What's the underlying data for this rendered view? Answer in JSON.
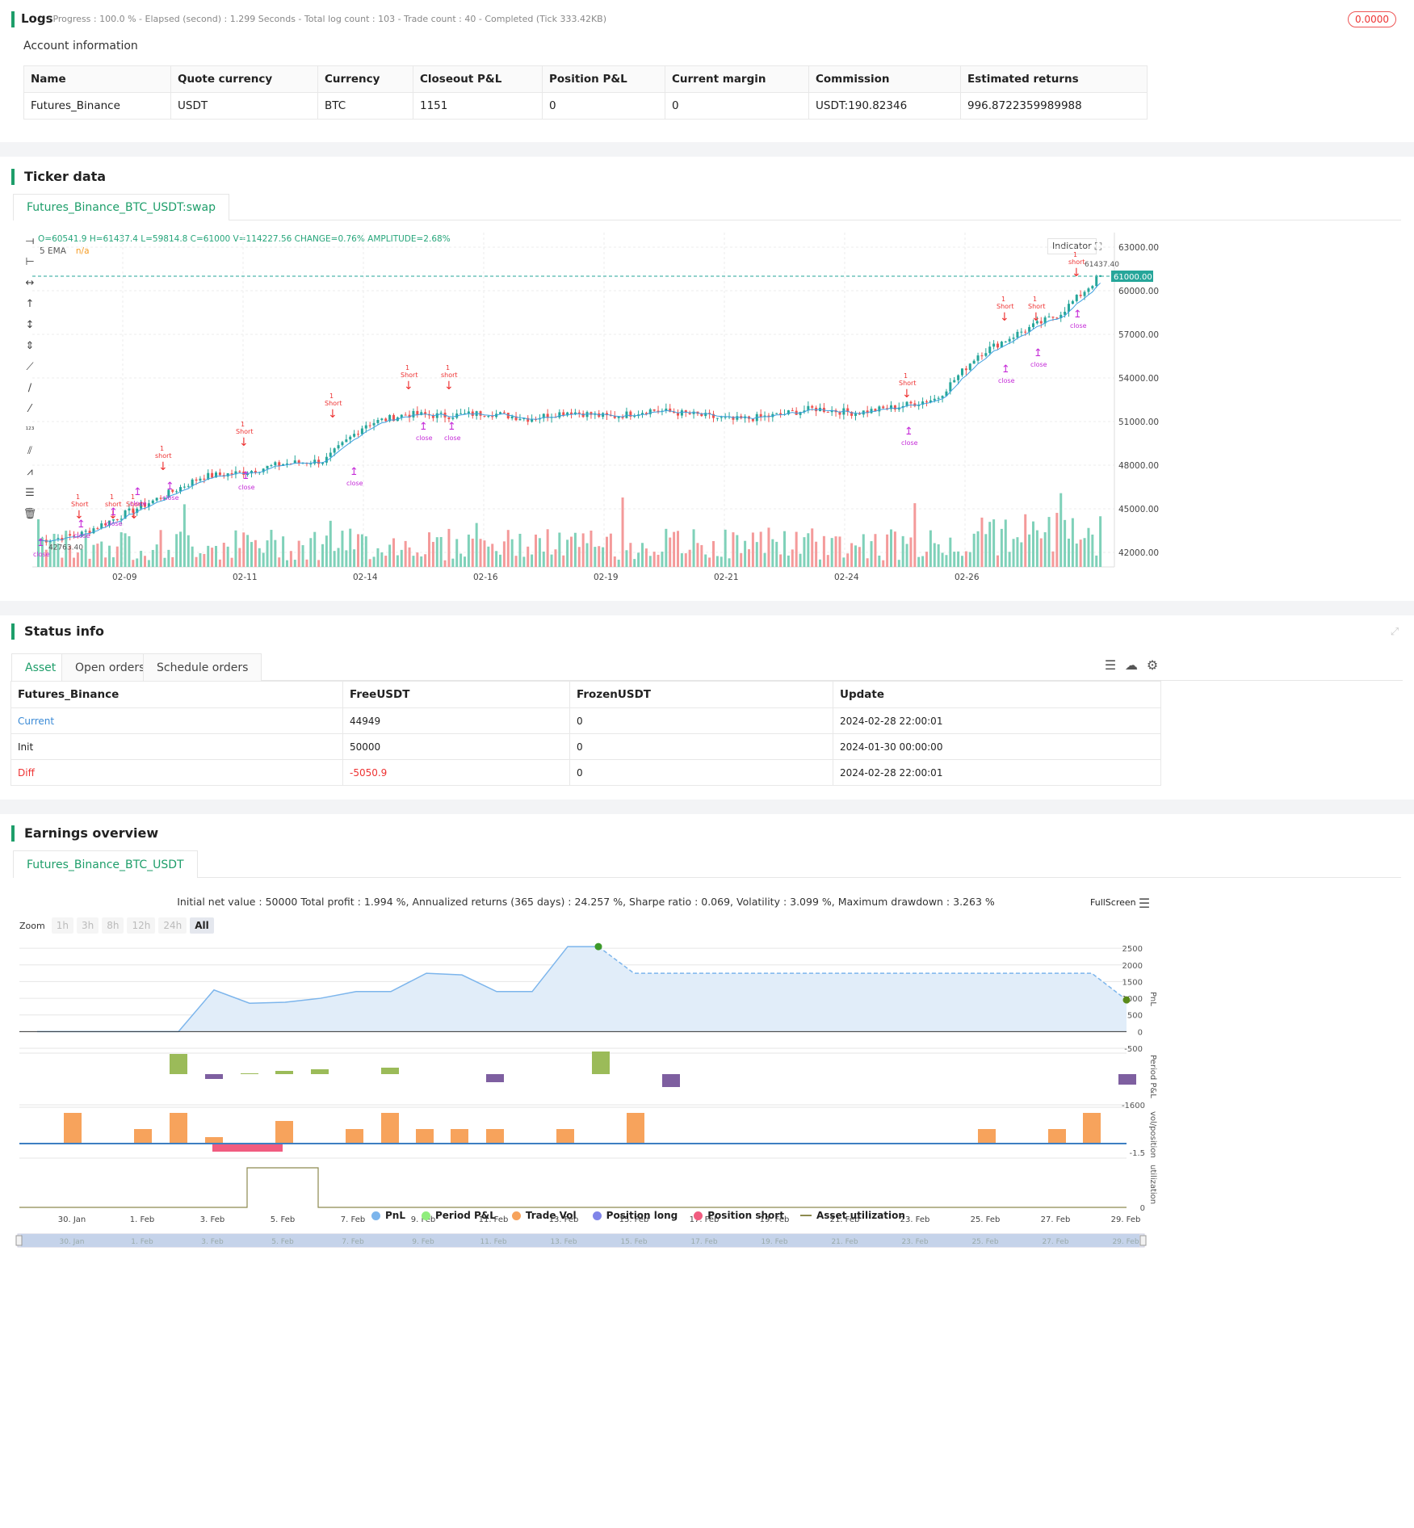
{
  "logs": {
    "title": "Logs",
    "summary": "- Progress : 100.0 % - Elapsed (second) : 1.299  Seconds - Total log count : 103 - Trade count : 40 - Completed (Tick 333.42KB)",
    "badge": "0.0000"
  },
  "account": {
    "title": "Account information",
    "headers": [
      "Name",
      "Quote currency",
      "Currency",
      "Closeout P&L",
      "Position P&L",
      "Current margin",
      "Commission",
      "Estimated returns"
    ],
    "row": [
      "Futures_Binance",
      "USDT",
      "BTC",
      "1151",
      "0",
      "0",
      "USDT:190.82346",
      "996.8722359989988"
    ]
  },
  "ticker": {
    "title": "Ticker data",
    "tab": "Futures_Binance_BTC_USDT:swap",
    "ohlc": "O=60541.9 H=61437.4 L=59814.8 C=61000 V=114227.56 CHANGE=0.76% AMPLITUDE=2.68%",
    "ema_label": "5 EMA",
    "ema_value": "n/a",
    "indicator_btn": "Indicator",
    "price_tag": "61000.00",
    "high_label": "61437.40",
    "low_label": "42763.40",
    "y_ticks": [
      "63000.00",
      "60000.00",
      "57000.00",
      "54000.00",
      "51000.00",
      "48000.00",
      "45000.00",
      "42000.00"
    ],
    "x_ticks": [
      "02-09",
      "02-11",
      "02-14",
      "02-16",
      "02-19",
      "02-21",
      "02-24",
      "02-26"
    ],
    "marker_short": "short",
    "marker_Short": "Short",
    "marker_close": "close",
    "marker_one": "1"
  },
  "status": {
    "title": "Status info",
    "tabs": [
      "Asset",
      "Open orders",
      "Schedule orders"
    ],
    "headers": [
      "Futures_Binance",
      "FreeUSDT",
      "FrozenUSDT",
      "Update"
    ],
    "rows": [
      [
        "Current",
        "44949",
        "0",
        "2024-02-28 22:00:01"
      ],
      [
        "Init",
        "50000",
        "0",
        "2024-01-30 00:00:00"
      ],
      [
        "Diff",
        "-5050.9",
        "0",
        "2024-02-28 22:00:01"
      ]
    ]
  },
  "earnings": {
    "title": "Earnings overview",
    "tab": "Futures_Binance_BTC_USDT",
    "summary": "Initial net value : 50000 Total profit : 1.994 %, Annualized returns (365 days) : 24.257 %, Sharpe ratio : 0.069, Volatility : 3.099 %, Maximum drawdown : 3.263 %",
    "fullscreen": "FullScreen",
    "zoom_label": "Zoom",
    "zoom_buttons": [
      "1h",
      "3h",
      "8h",
      "12h",
      "24h",
      "All"
    ],
    "pnl_ticks": [
      "2500",
      "2000",
      "1500",
      "1000",
      "500",
      "0",
      "-500"
    ],
    "axis_labels": {
      "pnl": "PnL",
      "period": "Period P&L",
      "vol": "vol/position",
      "util": "utilization"
    },
    "period_tick": "-1600",
    "vol_tick": "-1.5",
    "util_tick": "0",
    "x_ticks": [
      "30. Jan",
      "1. Feb",
      "3. Feb",
      "5. Feb",
      "7. Feb",
      "9. Feb",
      "11. Feb",
      "13. Feb",
      "15. Feb",
      "17. Feb",
      "19. Feb",
      "21. Feb",
      "23. Feb",
      "25. Feb",
      "27. Feb",
      "29. Feb"
    ],
    "legend": [
      {
        "name": "PnL",
        "color": "#7cb5ec"
      },
      {
        "name": "Period P&L",
        "color": "#90ed7d"
      },
      {
        "name": "Trade Vol",
        "color": "#f7a35c"
      },
      {
        "name": "Position long",
        "color": "#8085e9"
      },
      {
        "name": "Position short",
        "color": "#f15c80"
      },
      {
        "name": "Asset utilization",
        "color": "#8d8a4f"
      }
    ]
  },
  "chart_data": [
    {
      "type": "candlestick",
      "title": "Futures_Binance_BTC_USDT:swap",
      "ylim": [
        41000,
        64000
      ],
      "x": [
        "02-09",
        "02-11",
        "02-14",
        "02-16",
        "02-19",
        "02-21",
        "02-24",
        "02-26"
      ],
      "close_path": [
        42800,
        43200,
        44500,
        45800,
        47200,
        47500,
        48100,
        48300,
        50800,
        51500,
        51400,
        51600,
        51200,
        51700,
        51300,
        51800,
        51500,
        51100,
        51400,
        51900,
        51600,
        52000,
        52600,
        55600,
        57100,
        58400,
        61000
      ],
      "series": [
        {
          "name": "5 EMA"
        }
      ]
    },
    {
      "type": "line",
      "title": "PnL",
      "ylim": [
        -500,
        2600
      ],
      "x": [
        "30. Jan",
        "1. Feb",
        "3. Feb",
        "5. Feb",
        "7. Feb",
        "9. Feb",
        "11. Feb",
        "13. Feb",
        "15. Feb",
        "17. Feb",
        "19. Feb",
        "21. Feb",
        "23. Feb",
        "25. Feb",
        "27. Feb",
        "29. Feb"
      ],
      "values": [
        0,
        0,
        1250,
        850,
        1100,
        1400,
        1850,
        1200,
        2550,
        1750,
        1750,
        1750,
        1750,
        1750,
        1750,
        950
      ]
    }
  ]
}
